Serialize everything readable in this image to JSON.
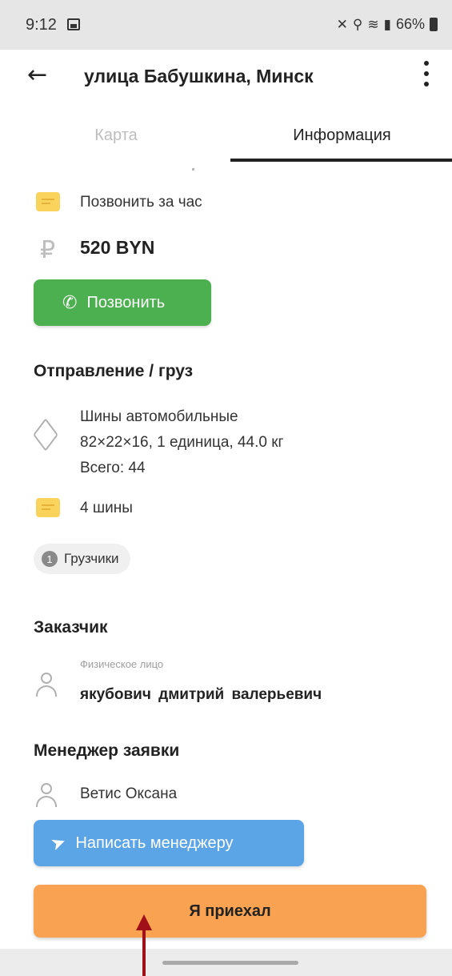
{
  "status_bar": {
    "time": "9:12",
    "battery": "66%"
  },
  "app_bar": {
    "title": "улица Бабушкина, Минск"
  },
  "tabs": [
    {
      "label": "Карта",
      "active": false
    },
    {
      "label": "Информация",
      "active": true
    }
  ],
  "order": {
    "comment": "Позвонить за час",
    "price": "520 BYN",
    "call_button": "Позвонить"
  },
  "cargo": {
    "section_title": "Отправление / груз",
    "lines": [
      "Шины автомобильные",
      "82×22×16, 1 единица, 44.0 кг",
      "Всего: 44"
    ],
    "comment": "4 шины",
    "chip_count": "1",
    "chip_label": "Грузчики"
  },
  "customer": {
    "section_title": "Заказчик",
    "type_label": "Физическое лицо",
    "name": "якубович дмитрий  валерьевич"
  },
  "manager": {
    "section_title": "Менеджер заявки",
    "name": "Ветис Оксана",
    "message_button": "Написать менеджеру"
  },
  "actions": {
    "arrived_button": "Я приехал"
  },
  "colors": {
    "call_button": "#4caf50",
    "message_button": "#5ba4e6",
    "arrived_button": "#f9a251",
    "annotation_arrow": "#a01018"
  }
}
